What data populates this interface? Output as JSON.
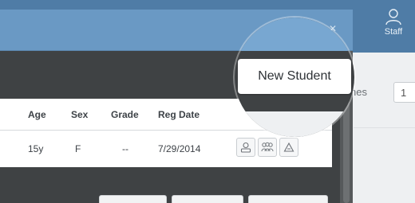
{
  "header": {
    "staff_label": "Staff"
  },
  "right_page": {
    "partial_text": "hes",
    "box_value": "1"
  },
  "spotlight": {
    "new_student_label": "New Student"
  },
  "table": {
    "columns": [
      "Age",
      "Sex",
      "Grade",
      "Reg Date"
    ],
    "rows": [
      {
        "age": "15y",
        "sex": "F",
        "grade": "--",
        "reg_date": "7/29/2014"
      }
    ],
    "actions": [
      "user-icon",
      "group-icon",
      "triangle-icon"
    ]
  },
  "colors": {
    "topbar": "#4f7ca6",
    "dialog_header": "#6a99c4",
    "dialog_body": "#3f4244"
  }
}
